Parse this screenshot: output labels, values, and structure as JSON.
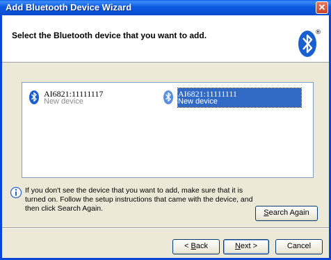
{
  "window": {
    "title": "Add Bluetooth Device Wizard",
    "close_glyph": "✕"
  },
  "header": {
    "text": "Select the Bluetooth device that you want to add.",
    "logo_icon": "bluetooth-logo-icon",
    "logo_mark": "®"
  },
  "devices": [
    {
      "name": "AI6821:11111117",
      "status": "New device",
      "icon": "bluetooth-icon",
      "selected": false
    },
    {
      "name": "AI6821:11111111",
      "status": "New device",
      "icon": "bluetooth-icon",
      "selected": true
    }
  ],
  "info": {
    "icon": "info-icon",
    "text": "If you don't see the device that you want to add, make sure that it is turned on. Follow the setup instructions that came with the device, and then click Search Again."
  },
  "buttons": {
    "search_again": {
      "pre": "",
      "mnemonic": "S",
      "post": "earch Again"
    },
    "back": {
      "pre": "< ",
      "mnemonic": "B",
      "post": "ack"
    },
    "next": {
      "pre": "",
      "mnemonic": "N",
      "post": "ext >"
    },
    "cancel": {
      "pre": "Cancel",
      "mnemonic": "",
      "post": ""
    }
  },
  "colors": {
    "titlebar": "#0a5ae0",
    "selection": "#316ac5",
    "bluetooth": "#1a5fd0"
  }
}
